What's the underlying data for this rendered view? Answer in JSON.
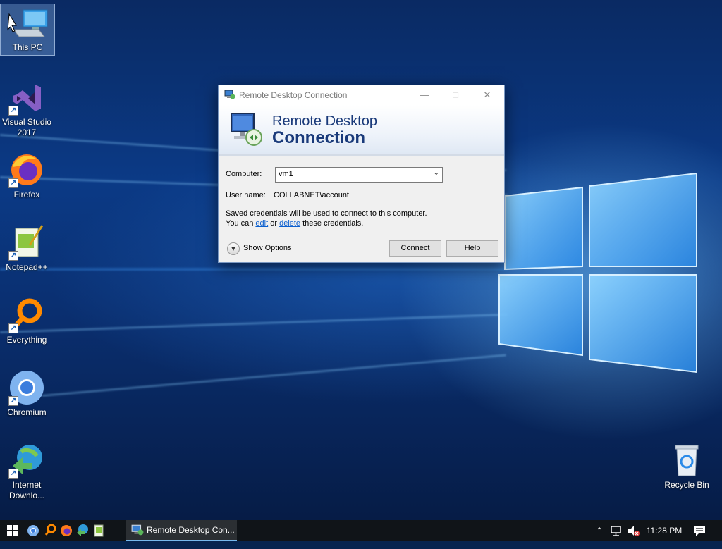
{
  "desktop": {
    "icons": [
      {
        "label": "This PC",
        "icon": "computer-icon"
      },
      {
        "label": "Visual Studio 2017",
        "icon": "visual-studio-icon"
      },
      {
        "label": "Firefox",
        "icon": "firefox-icon"
      },
      {
        "label": "Notepad++",
        "icon": "notepad-plus-plus-icon"
      },
      {
        "label": "Everything",
        "icon": "everything-search-icon"
      },
      {
        "label": "Chromium",
        "icon": "chromium-icon"
      },
      {
        "label": "Internet Downlo...",
        "icon": "internet-download-manager-icon"
      },
      {
        "label": "Recycle Bin",
        "icon": "recycle-bin-icon"
      }
    ]
  },
  "dialog": {
    "title": "Remote Desktop Connection",
    "banner_line1": "Remote Desktop",
    "banner_line2": "Connection",
    "computer_label": "Computer:",
    "computer_value": "vm1",
    "username_label": "User name:",
    "username_value": "COLLABNET\\account",
    "saved_line1": "Saved credentials will be used to connect to this computer.",
    "saved_line2_prefix": "You can ",
    "edit_link": "edit",
    "saved_line2_or": " or ",
    "delete_link": "delete",
    "saved_line2_suffix": " these credentials.",
    "show_options": "Show Options",
    "connect_button": "Connect",
    "help_button": "Help"
  },
  "taskbar": {
    "pinned": [
      "chromium-icon",
      "everything-search-icon",
      "firefox-icon",
      "internet-download-manager-icon",
      "notepad-plus-plus-icon"
    ],
    "active_app": "Remote Desktop Con...",
    "clock": "11:28 PM"
  },
  "colors": {
    "accent": "#0b5fcf",
    "taskbar_bg": "#101418",
    "banner_text": "#1a3a7a"
  }
}
